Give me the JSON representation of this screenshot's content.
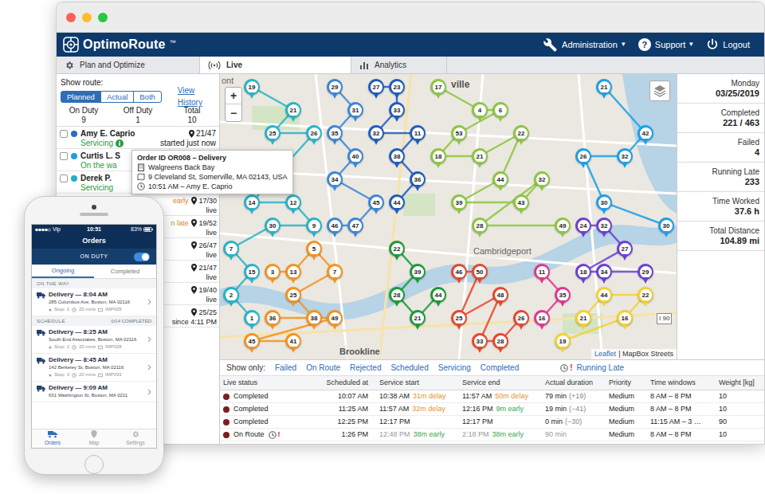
{
  "app": {
    "logo": "OptimoRoute",
    "trademark": "™"
  },
  "header_menu": [
    {
      "label": "Administration",
      "caret": "▾"
    },
    {
      "label": "Support",
      "icon_text": "?",
      "caret": "▾"
    },
    {
      "label": "Logout"
    }
  ],
  "tabs": [
    {
      "label": "Plan and Optimize",
      "selected": false
    },
    {
      "label": "Live",
      "selected": true
    },
    {
      "label": "Analytics",
      "selected": false
    }
  ],
  "route_panel": {
    "label": "Show route:",
    "modes": [
      {
        "label": "Planned",
        "selected": true
      },
      {
        "label": "Actual",
        "selected": false
      },
      {
        "label": "Both",
        "selected": false
      }
    ],
    "history_link": "View History",
    "duty": [
      {
        "label": "On Duty",
        "value": "9"
      },
      {
        "label": "Off Duty",
        "value": "1"
      },
      {
        "label": "Total",
        "value": "10"
      }
    ],
    "drivers": [
      {
        "kind": "full",
        "name": "Amy E. Caprio",
        "status": "Servicing",
        "info": true,
        "count": "21/47",
        "note": "started just now",
        "checked": false,
        "color": "#2b6cc4"
      },
      {
        "kind": "full",
        "name": "Curtis L. S",
        "status": "On the wa",
        "info": false,
        "checked": false,
        "color": "#1f9ee0"
      },
      {
        "kind": "full",
        "name": "Derek P.",
        "status": "Servicing",
        "info": false,
        "checked": false,
        "color": "#21b0c4"
      },
      {
        "kind": "covered",
        "status": "early",
        "count": "17/30",
        "note": "live"
      },
      {
        "kind": "covered",
        "status": "n late",
        "count": "19/52",
        "note": "live"
      },
      {
        "kind": "covered",
        "count": "26/47",
        "note": "live"
      },
      {
        "kind": "covered",
        "count": "21/47",
        "note": "live"
      },
      {
        "kind": "covered",
        "count": "19/40",
        "note": "live"
      },
      {
        "kind": "covered",
        "count": "25/25",
        "note": "since 4:11 PM"
      }
    ]
  },
  "tooltip": {
    "title": "Order ID OR008 – Delivery",
    "place": "Walgreens Back Bay",
    "address": "9 Cleveland St, Somerville, MA 02143, USA",
    "time": "10:51 AM – Amy E. Caprio"
  },
  "map": {
    "zoom_in": "+",
    "zoom_out": "−",
    "labels": [
      {
        "text": "ont"
      },
      {
        "text": "ville"
      },
      {
        "text": "Cambridgeport"
      },
      {
        "text": "Brookline"
      },
      {
        "text": "I 90"
      }
    ],
    "attribution_link": "Leaflet",
    "attribution": "| MapBox Streets",
    "pins": [
      {
        "label": "19",
        "color": "#23b4c8"
      },
      {
        "label": "21",
        "color": "#23b4c8"
      },
      {
        "label": "25",
        "color": "#23b4c8"
      },
      {
        "label": "26",
        "color": "#23b4c8"
      },
      {
        "label": "14",
        "color": "#23b4c8"
      },
      {
        "label": "12",
        "color": "#23b4c8"
      },
      {
        "label": "9",
        "color": "#23b4c8"
      },
      {
        "label": "30",
        "color": "#23b4c8"
      },
      {
        "label": "7",
        "color": "#23b4c8"
      },
      {
        "label": "15",
        "color": "#23b4c8"
      },
      {
        "label": "2",
        "color": "#23b4c8"
      },
      {
        "label": "1",
        "color": "#23b4c8"
      },
      {
        "label": "29",
        "color": "#3b86d6"
      },
      {
        "label": "31",
        "color": "#3b86d6"
      },
      {
        "label": "35",
        "color": "#3b86d6"
      },
      {
        "label": "40",
        "color": "#3b86d6"
      },
      {
        "label": "34",
        "color": "#3b86d6"
      },
      {
        "label": "45",
        "color": "#3b86d6"
      },
      {
        "label": "47",
        "color": "#3b86d6"
      },
      {
        "label": "46",
        "color": "#3b86d6"
      },
      {
        "label": "27",
        "color": "#1e5cbf"
      },
      {
        "label": "23",
        "color": "#1e5cbf"
      },
      {
        "label": "33",
        "color": "#1e5cbf"
      },
      {
        "label": "32",
        "color": "#1e5cbf"
      },
      {
        "label": "11",
        "color": "#1e5cbf"
      },
      {
        "label": "38",
        "color": "#1e5cbf"
      },
      {
        "label": "36",
        "color": "#1e5cbf"
      },
      {
        "label": "44",
        "color": "#1e5cbf"
      },
      {
        "label": "17",
        "color": "#8cc63f"
      },
      {
        "label": "4",
        "color": "#8cc63f"
      },
      {
        "label": "6",
        "color": "#8cc63f"
      },
      {
        "label": "53",
        "color": "#8cc63f"
      },
      {
        "label": "18",
        "color": "#8cc63f"
      },
      {
        "label": "21",
        "color": "#8cc63f"
      },
      {
        "label": "22",
        "color": "#8cc63f"
      },
      {
        "label": "44",
        "color": "#8cc63f"
      },
      {
        "label": "39",
        "color": "#8cc63f"
      },
      {
        "label": "43",
        "color": "#8cc63f"
      },
      {
        "label": "32",
        "color": "#8cc63f"
      },
      {
        "label": "28",
        "color": "#8cc63f"
      },
      {
        "label": "49",
        "color": "#8cc63f"
      },
      {
        "label": "21",
        "color": "#1a9fe8"
      },
      {
        "label": "42",
        "color": "#1a9fe8"
      },
      {
        "label": "32",
        "color": "#1a9fe8"
      },
      {
        "label": "26",
        "color": "#1a9fe8"
      },
      {
        "label": "30",
        "color": "#1a9fe8"
      },
      {
        "label": "30",
        "color": "#1a9fe8"
      },
      {
        "label": "3",
        "color": "#f5921e"
      },
      {
        "label": "13",
        "color": "#f5921e"
      },
      {
        "label": "5",
        "color": "#f5921e"
      },
      {
        "label": "7",
        "color": "#f5921e"
      },
      {
        "label": "25",
        "color": "#f5921e"
      },
      {
        "label": "38",
        "color": "#f5921e"
      },
      {
        "label": "36",
        "color": "#f5921e"
      },
      {
        "label": "49",
        "color": "#f5921e"
      },
      {
        "label": "45",
        "color": "#f5921e"
      },
      {
        "label": "41",
        "color": "#f5921e"
      },
      {
        "label": "22",
        "color": "#1a9b3a"
      },
      {
        "label": "39",
        "color": "#1a9b3a"
      },
      {
        "label": "28",
        "color": "#1a9b3a"
      },
      {
        "label": "21",
        "color": "#1a9b3a"
      },
      {
        "label": "44",
        "color": "#1a9b3a"
      },
      {
        "label": "46",
        "color": "#e8452c"
      },
      {
        "label": "50",
        "color": "#e8452c"
      },
      {
        "label": "25",
        "color": "#e8452c"
      },
      {
        "label": "48",
        "color": "#e8452c"
      },
      {
        "label": "33",
        "color": "#e8452c"
      },
      {
        "label": "28",
        "color": "#e8452c"
      },
      {
        "label": "26",
        "color": "#e8452c"
      },
      {
        "label": "11",
        "color": "#e0368f"
      },
      {
        "label": "35",
        "color": "#e0368f"
      },
      {
        "label": "16",
        "color": "#e0368f"
      },
      {
        "label": "24",
        "color": "#6b3fd3"
      },
      {
        "label": "32",
        "color": "#6b3fd3"
      },
      {
        "label": "27",
        "color": "#6b3fd3"
      },
      {
        "label": "18",
        "color": "#6b3fd3"
      },
      {
        "label": "34",
        "color": "#6b3fd3"
      },
      {
        "label": "29",
        "color": "#6b3fd3"
      },
      {
        "label": "21",
        "color": "#f2d230"
      },
      {
        "label": "44",
        "color": "#f2d230"
      },
      {
        "label": "22",
        "color": "#f2d230"
      },
      {
        "label": "16",
        "color": "#f2d230"
      },
      {
        "label": "19",
        "color": "#f2d230"
      }
    ]
  },
  "stats": [
    {
      "label": "Monday",
      "value": "03/25/2019"
    },
    {
      "label": "Completed",
      "value": "221 / 463"
    },
    {
      "label": "Failed",
      "value": "4"
    },
    {
      "label": "Running Late",
      "value": "233"
    },
    {
      "label": "Time Worked",
      "value": "37.6 h"
    },
    {
      "label": "Total Distance",
      "value": "104.89 mi"
    }
  ],
  "orders_table": {
    "filter_label": "Show only:",
    "filters": [
      "Failed",
      "On Route",
      "Rejected",
      "Scheduled",
      "Servicing",
      "Completed"
    ],
    "late_filter": {
      "alert": "!",
      "label": "Running Late"
    },
    "columns": [
      "Live status",
      "Scheduled at",
      "Service start",
      "Service end",
      "Actual duration",
      "Priority",
      "Time windows",
      "Weight [kg]"
    ],
    "rows": [
      {
        "color": "#7a1f1f",
        "status": "Completed",
        "late": false,
        "scheduled": "10:07 AM",
        "start": {
          "time": "10:38 AM",
          "delta": "31m delay",
          "delta_kind": "delay",
          "estimated": false
        },
        "end": {
          "time": "11:57 AM",
          "delta": "50m delay",
          "delta_kind": "delay",
          "estimated": false
        },
        "duration": {
          "text": "79 min",
          "diff": "(+19)",
          "estimated": false
        },
        "priority": "Medium",
        "window": "8 AM – 8 PM",
        "weight": "10"
      },
      {
        "color": "#7a1f1f",
        "status": "Completed",
        "late": false,
        "scheduled": "11:25 AM",
        "start": {
          "time": "11:57 AM",
          "delta": "32m delay",
          "delta_kind": "delay",
          "estimated": false
        },
        "end": {
          "time": "12:16 PM",
          "delta": "9m early",
          "delta_kind": "early",
          "estimated": false
        },
        "duration": {
          "text": "19 min",
          "diff": "(−41)",
          "estimated": false
        },
        "priority": "Medium",
        "window": "8 AM – 8 PM",
        "weight": "10"
      },
      {
        "color": "#7a1f1f",
        "status": "Completed",
        "late": false,
        "scheduled": "12:25 PM",
        "start": {
          "time": "12:17 PM",
          "estimated": false
        },
        "end": {
          "time": "12:17 PM",
          "estimated": false
        },
        "duration": {
          "text": "0 min",
          "diff": "(−30)",
          "estimated": false
        },
        "priority": "Medium",
        "window": "11:15 AM – 3 …",
        "weight": "90"
      },
      {
        "color": "#7a1f1f",
        "status": "On Route",
        "late": true,
        "alert": "!",
        "scheduled": "1:26 PM",
        "start": {
          "time": "12:48 PM",
          "delta": "38m early",
          "delta_kind": "early",
          "estimated": true
        },
        "end": {
          "time": "2:18 PM",
          "delta": "38m early",
          "delta_kind": "early",
          "estimated": true
        },
        "duration": {
          "text": "90 min",
          "estimated": true
        },
        "priority": "Medium",
        "window": "8 AM – 8 PM",
        "weight": "10"
      }
    ]
  },
  "phone": {
    "carrier": "Vip",
    "time": "10:51",
    "battery": "83%",
    "title": "Orders",
    "duty_label": "ON DUTY",
    "duty_on": true,
    "tabs": [
      {
        "label": "Ongoing",
        "selected": true
      },
      {
        "label": "Completed",
        "selected": false
      }
    ],
    "sections": [
      {
        "title": "ON THE WAY",
        "orders": [
          {
            "title": "Delivery — 8:04 AM",
            "address": "285 Columbus Ave, Boston, MA 02116",
            "stop": "Stop: 1",
            "duration": "20 mins",
            "ref": "IMP005"
          }
        ]
      },
      {
        "title": "SCHEDULE",
        "summary": "0/14 COMPLETED",
        "orders": [
          {
            "title": "Delivery — 8:25 AM",
            "address": "South End Associates, Boston, MA 02116",
            "stop": "Stop: 2",
            "duration": "20 mins",
            "ref": "IMP028"
          },
          {
            "title": "Delivery — 8:45 AM",
            "address": "142 Berkeley St, Boston, MA 02116",
            "stop": "Stop: 3",
            "duration": "20 mins",
            "ref": "IMP033"
          },
          {
            "title": "Delivery — 9:09 AM",
            "address": "631 Washington St, Boston, MA 0211"
          }
        ]
      }
    ],
    "nav": [
      {
        "label": "Orders",
        "selected": true
      },
      {
        "label": "Map",
        "selected": false
      },
      {
        "label": "Settings",
        "selected": false
      }
    ]
  }
}
